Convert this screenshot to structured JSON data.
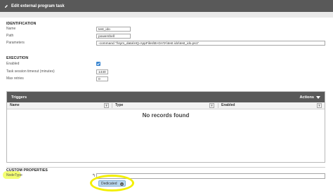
{
  "window": {
    "title": "Edit external program task"
  },
  "identification": {
    "heading": "IDENTIFICATION",
    "name_label": "Name",
    "name_value": "test_ido",
    "path_label": "Path",
    "path_value": "powershell",
    "parameters_label": "Parameters",
    "parameters_value": "-command \"\\\\sym_data\\HQ-AppFiles\\BI-DATA\\test ido\\test_ido.ps1\""
  },
  "execution": {
    "heading": "EXECUTION",
    "enabled_label": "Enabled",
    "enabled_checked": true,
    "timeout_label": "Task session timeout (minutes)",
    "timeout_value": "1440",
    "retries_label": "Max retries",
    "retries_value": "0"
  },
  "triggers": {
    "title": "Triggers",
    "actions_label": "Actions",
    "columns": [
      "Name",
      "Type",
      "Enabled"
    ],
    "empty_message": "No records found"
  },
  "custom_properties": {
    "heading": "CUSTOM PROPERTIES",
    "nodetype_label": "NodeType",
    "selected_tag": "Dedicated",
    "highlight_color": "#f3ef00"
  },
  "colors": {
    "titlebar": "#595959",
    "checkbox": "#3a86d1",
    "tag": "#b9d7ee"
  }
}
